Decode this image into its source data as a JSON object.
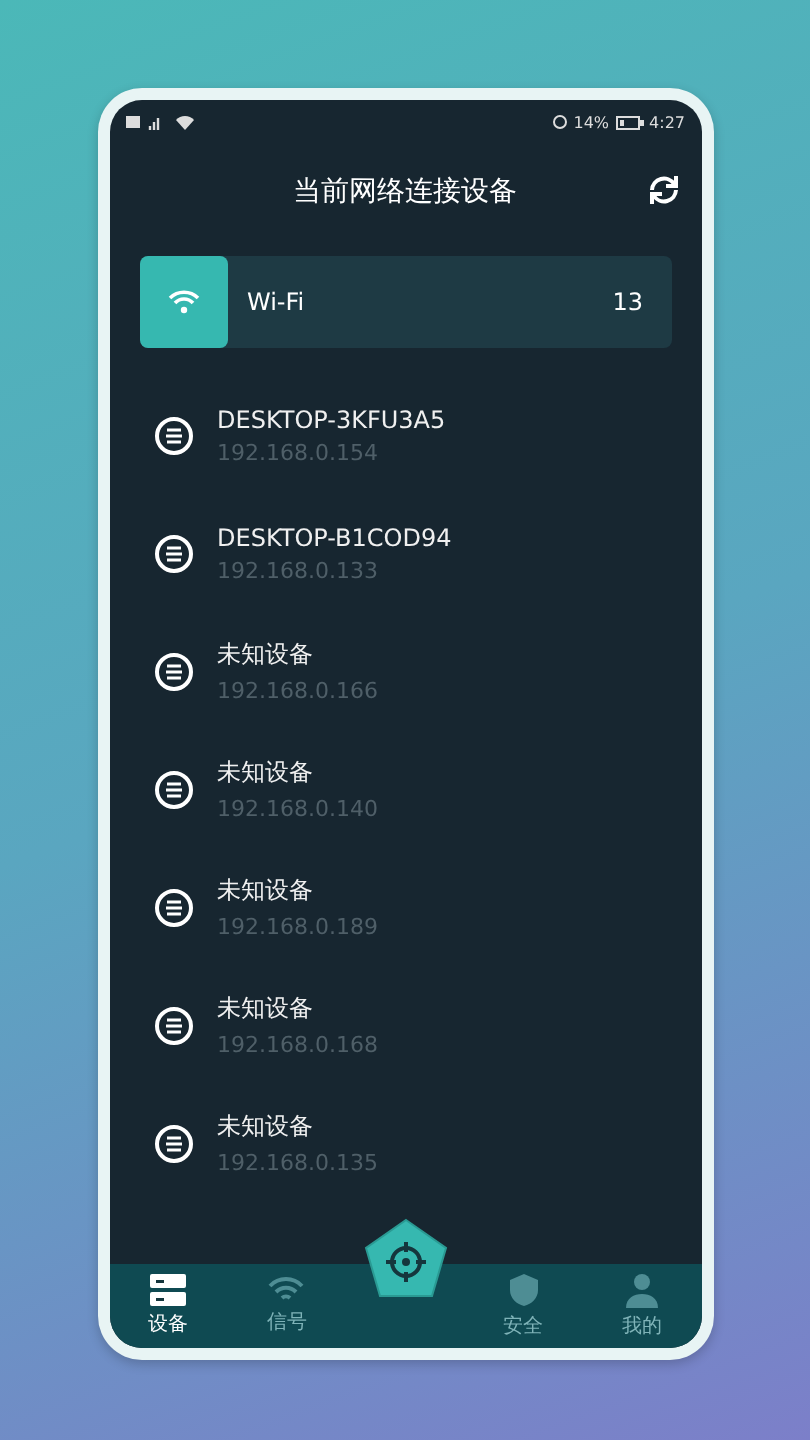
{
  "status_bar": {
    "battery": "14%",
    "time": "4:27"
  },
  "header": {
    "title": "当前网络连接设备"
  },
  "network": {
    "name": "Wi-Fi",
    "count": "13"
  },
  "devices": [
    {
      "name": "DESKTOP-3KFU3A5",
      "ip": "192.168.0.154"
    },
    {
      "name": "DESKTOP-B1COD94",
      "ip": "192.168.0.133"
    },
    {
      "name": "未知设备",
      "ip": "192.168.0.166"
    },
    {
      "name": "未知设备",
      "ip": "192.168.0.140"
    },
    {
      "name": "未知设备",
      "ip": "192.168.0.189"
    },
    {
      "name": "未知设备",
      "ip": "192.168.0.168"
    },
    {
      "name": "未知设备",
      "ip": "192.168.0.135"
    }
  ],
  "tabs": [
    {
      "kind": "devices",
      "label": "设备",
      "selected": true
    },
    {
      "kind": "signal",
      "label": "信号",
      "selected": false
    },
    {
      "kind": "scan",
      "selected": false
    },
    {
      "kind": "security",
      "label": "安全",
      "selected": false
    },
    {
      "kind": "profile",
      "label": "我的",
      "selected": false
    }
  ]
}
